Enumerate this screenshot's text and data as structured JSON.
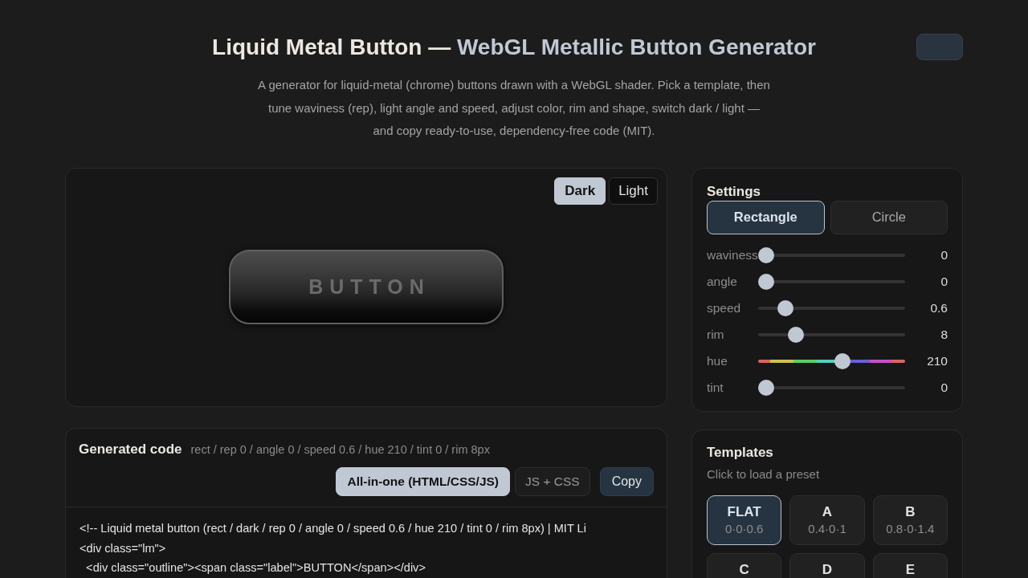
{
  "header": {
    "title": "Liquid Metal Button —",
    "title_accent": "WebGL Metallic Button Generator",
    "description": "A generator for liquid-metal (chrome) buttons drawn with a WebGL shader. Pick a template, then tune waviness (rep), light angle and speed, adjust color, rim and shape, switch dark / light — and copy ready-to-use, dependency-free code (MIT)."
  },
  "preview": {
    "theme_toggle": [
      {
        "label": "Dark",
        "selected": true
      },
      {
        "label": "Light",
        "selected": false
      }
    ],
    "button_label": "BUTTON"
  },
  "code": {
    "title": "Generated code",
    "summary": "rect / rep 0 / angle 0 / speed 0.6 / hue 210 / tint 0 / rim 8px",
    "formats": [
      {
        "label": "All-in-one (HTML/CSS/JS)",
        "selected": true
      },
      {
        "label": "JS + CSS",
        "selected": false
      }
    ],
    "copy_button": "Copy",
    "lines": [
      "<!-- Liquid metal button (rect / dark / rep 0 / angle 0 / speed 0.6 / hue 210 / tint 0 / rim 8px) | MIT Li",
      "<div class=\"lm\">",
      "  <div class=\"outline\"><span class=\"label\">BUTTON</span></div>"
    ]
  },
  "settings": {
    "title": "Settings",
    "shapes": [
      {
        "label": "Rectangle",
        "selected": true
      },
      {
        "label": "Circle",
        "selected": false
      }
    ],
    "sliders": [
      {
        "label": "waviness",
        "kind": "plain",
        "level": 0,
        "value": "0"
      },
      {
        "label": "angle",
        "kind": "plain",
        "level": 0,
        "value": "0"
      },
      {
        "label": "speed",
        "kind": "plain",
        "level": 0.15,
        "value": "0.6"
      },
      {
        "label": "rim",
        "kind": "plain",
        "level": 0.23,
        "value": "8"
      },
      {
        "label": "hue",
        "kind": "spectrum",
        "level": 0.583,
        "value": "210"
      },
      {
        "label": "tint",
        "kind": "plain",
        "level": 0,
        "value": "0"
      }
    ]
  },
  "templates": {
    "title": "Templates",
    "subtitle": "Click to load a preset",
    "items": [
      {
        "name": "FLAT",
        "params": "0·0·0.6",
        "selected": true
      },
      {
        "name": "A",
        "params": "0.4·0·1",
        "selected": false
      },
      {
        "name": "B",
        "params": "0.8·0·1.4",
        "selected": false
      },
      {
        "name": "C",
        "selected": false
      },
      {
        "name": "D",
        "selected": false
      },
      {
        "name": "E",
        "selected": false
      }
    ]
  }
}
